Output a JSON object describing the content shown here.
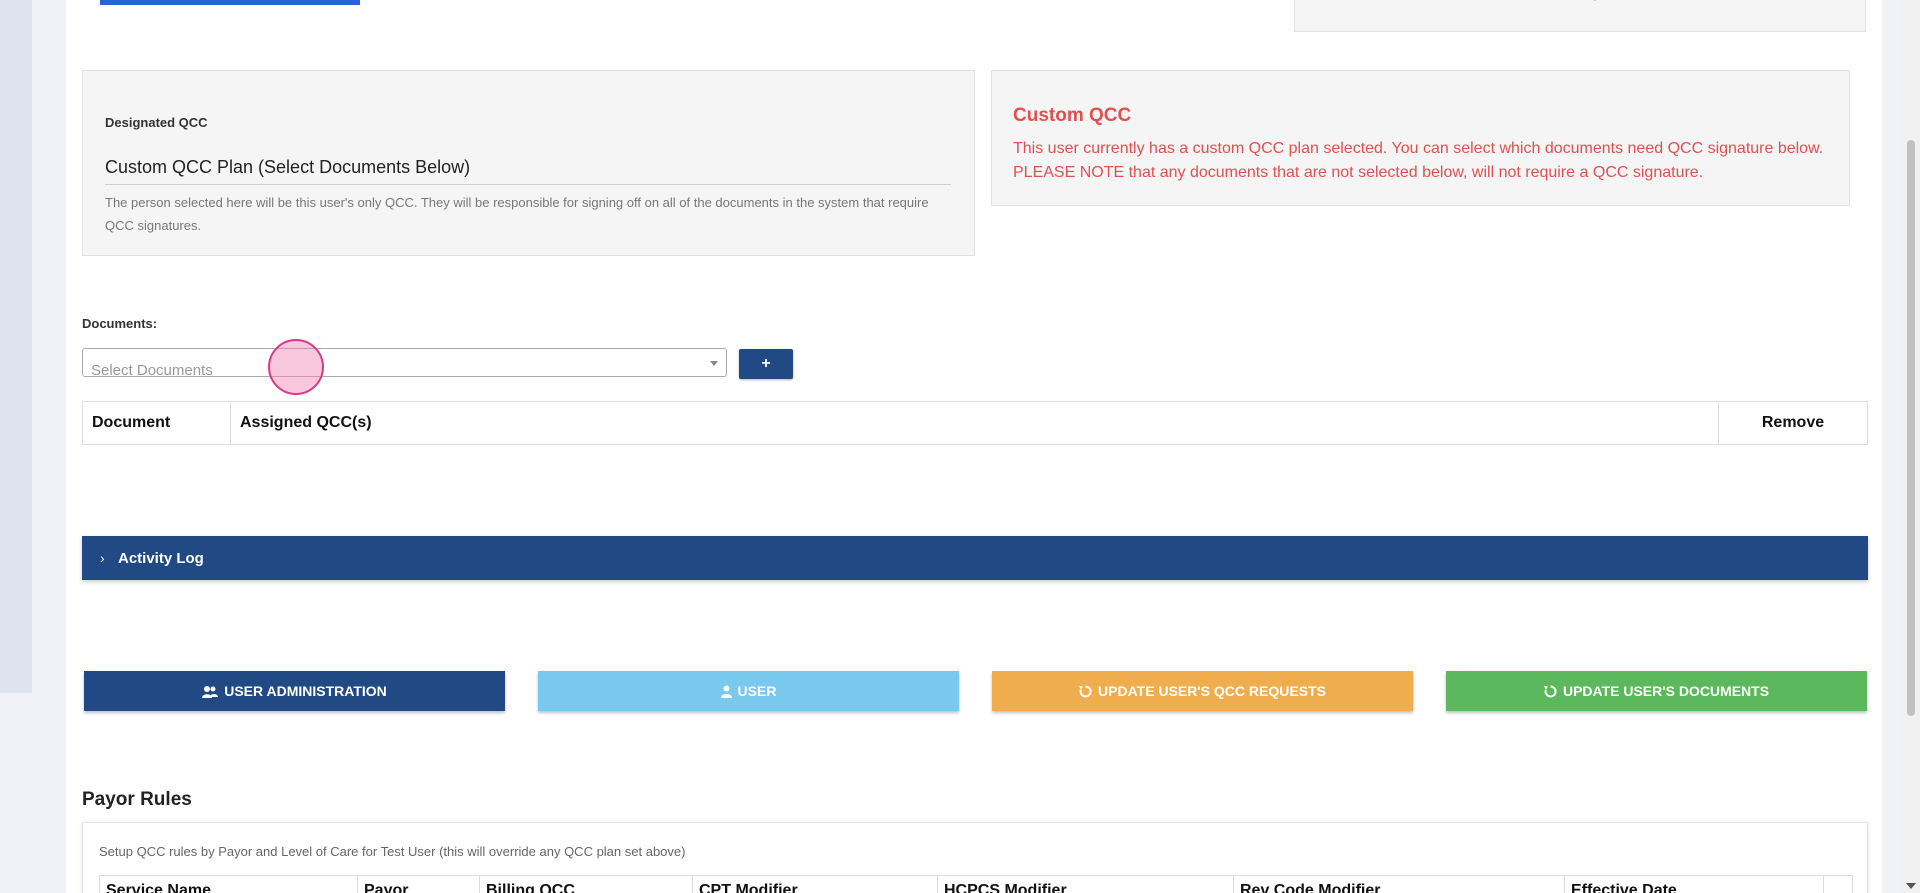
{
  "top_right_fragment": "·",
  "designated_qcc": {
    "label": "Designated QCC",
    "value": "Custom QCC Plan (Select Documents Below)",
    "help": "The person selected here will be this user's only QCC. They will be responsible for signing off on all of the documents in the system that require QCC signatures."
  },
  "custom_qcc": {
    "title": "Custom QCC",
    "message": "This user currently has a custom QCC plan selected. You can select which documents need QCC signature below. PLEASE NOTE that any documents that are not selected below, will not require a QCC signature."
  },
  "documents": {
    "label": "Documents:",
    "placeholder": "Select Documents",
    "add_label": "+"
  },
  "doc_table": {
    "columns": [
      "Document",
      "Assigned QCC(s)",
      "Remove"
    ]
  },
  "activity_log": {
    "label": "Activity Log"
  },
  "actions": {
    "user_admin": "USER ADMINISTRATION",
    "user": "USER",
    "update_qcc": "UPDATE USER'S QCC REQUESTS",
    "update_docs": "UPDATE USER'S DOCUMENTS"
  },
  "payor_rules": {
    "title": "Payor Rules",
    "description": "Setup QCC rules by Payor and Level of Care for Test User (this will override any QCC plan set above)",
    "columns": [
      "Service Name",
      "Payor",
      "Billing QCC",
      "CPT Modifier",
      "HCPCS Modifier",
      "Rev Code Modifier",
      "Effective Date",
      ""
    ]
  },
  "colors": {
    "primary": "#214a84",
    "info": "#78c9ed",
    "warning": "#f0ad4e",
    "success": "#5cb85c",
    "danger_text": "#e05050"
  }
}
